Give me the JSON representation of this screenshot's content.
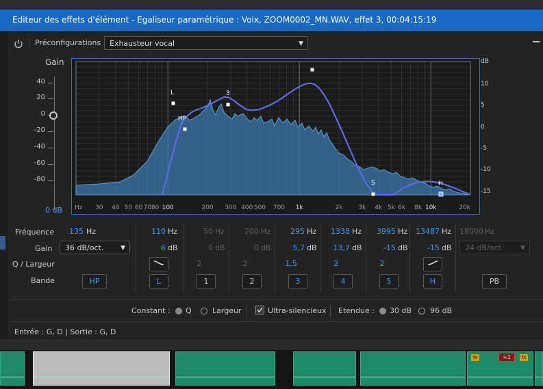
{
  "window": {
    "title": "Editeur des effets d'élément - Egaliseur paramétrique : Voix, ZOOM0002_MN.WAV, effet 3, 00:04:15:19"
  },
  "toolbar": {
    "presets_label": "Préconfigurations :",
    "preset_value": "Exhausteur vocal"
  },
  "gain_axis": {
    "title": "Gain",
    "ticks": [
      "40",
      "20",
      "0",
      "-20",
      "-40",
      "-60",
      "-80"
    ],
    "readout": "0",
    "readout_unit": "dB"
  },
  "db_axis": {
    "unit": "dB",
    "ticks": [
      "10",
      "5",
      "0",
      "-5",
      "-10",
      "-15"
    ]
  },
  "freq_axis": {
    "ticks": [
      "Hz",
      "30",
      "40",
      "50",
      "60",
      "70",
      "80",
      "100",
      "200",
      "300",
      "400",
      "500",
      "700",
      "1k",
      "2k",
      "3k",
      "4k",
      "5k",
      "6k",
      "8k",
      "10k",
      "20k"
    ]
  },
  "graph_labels": {
    "L": "L",
    "three": "3",
    "HP": "HP",
    "S": "S",
    "H": "H"
  },
  "row_labels": {
    "frequency": "Fréquence",
    "gain": "Gain",
    "q": "Q / Largeur",
    "band": "Bande"
  },
  "hp": {
    "freq": "135",
    "freq_unit": "Hz",
    "slope": "36 dB/oct.",
    "band": "HP"
  },
  "bands": [
    {
      "band": "L",
      "freq": "110",
      "gain": "6",
      "q": "",
      "enabled": true
    },
    {
      "band": "1",
      "freq": "50",
      "gain": "0",
      "q": "2",
      "enabled": false
    },
    {
      "band": "2",
      "freq": "200",
      "gain": "0",
      "q": "2",
      "enabled": false
    },
    {
      "band": "3",
      "freq": "295",
      "gain": "5,7",
      "q": "1,5",
      "enabled": true
    },
    {
      "band": "4",
      "freq": "1338",
      "gain": "13,7",
      "q": "2",
      "enabled": true
    },
    {
      "band": "5",
      "freq": "3995",
      "gain": "-15",
      "q": "2",
      "enabled": true
    },
    {
      "band": "H",
      "freq": "13487",
      "gain": "-15",
      "q": "",
      "enabled": true
    }
  ],
  "units": {
    "hz": "Hz",
    "db": "dB"
  },
  "lp": {
    "freq": "18000",
    "freq_unit": "Hz",
    "slope": "24 dB/oct.",
    "band": "PB"
  },
  "options": {
    "constant_label": "Constant :",
    "q_label": "Q",
    "width_label": "Largeur",
    "ultra_quiet_label": "Ultra-silencieux",
    "range_label": "Etendue :",
    "range_30": "30 dB",
    "range_96": "96 dB"
  },
  "status": {
    "io": "Entrée : G, D | Sortie : G, D"
  },
  "timeline": {
    "badge": "+1"
  },
  "colors": {
    "accent": "#3b99fc",
    "title_bar": "#1769c4",
    "curve": "#5a6fe0",
    "spectrum": "#4a8bc4",
    "audio_clip": "#1f8a68"
  }
}
